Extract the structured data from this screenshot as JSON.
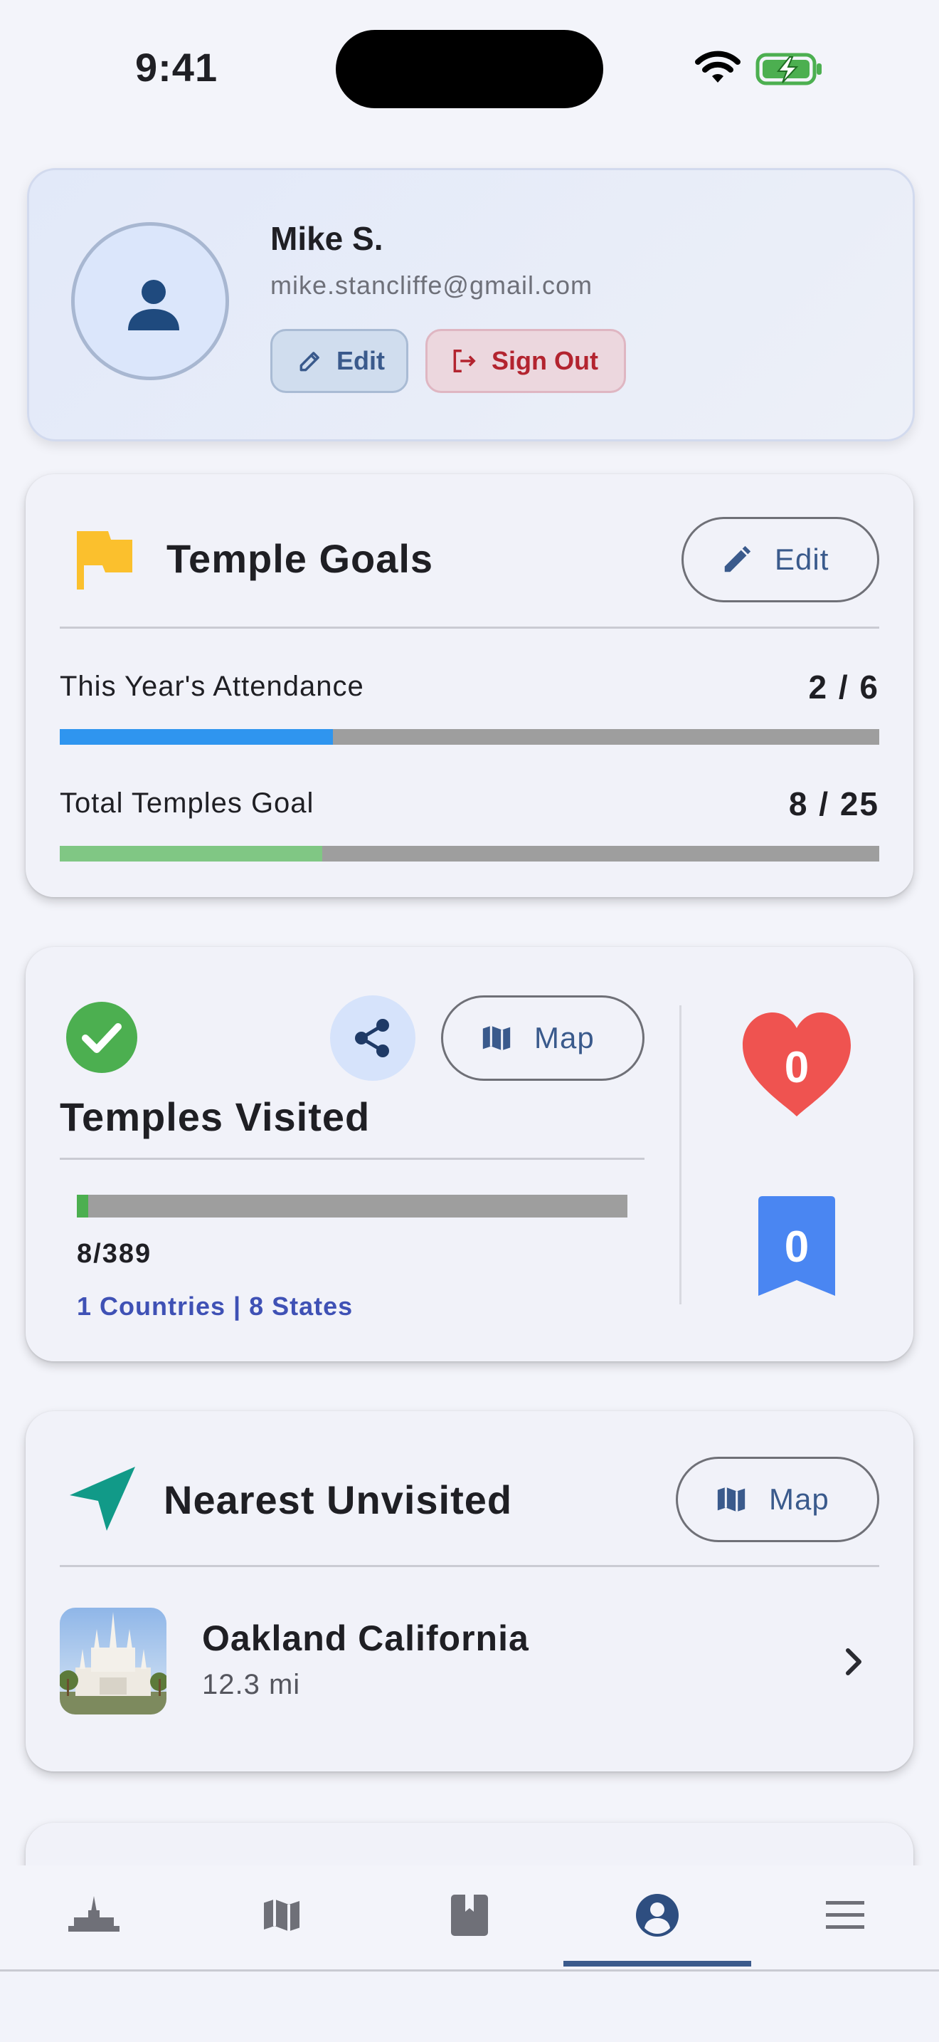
{
  "status_bar": {
    "time": "9:41"
  },
  "profile": {
    "name": "Mike S.",
    "email": "mike.stancliffe@gmail.com",
    "edit_label": "Edit",
    "signout_label": "Sign Out"
  },
  "goals": {
    "title": "Temple Goals",
    "edit_label": "Edit",
    "rows": [
      {
        "label": "This Year's Attendance",
        "value": "2 / 6",
        "progress": 0.333,
        "color": "#2f95ef"
      },
      {
        "label": "Total Temples Goal",
        "value": "8 / 25",
        "progress": 0.32,
        "color": "#80c784"
      }
    ]
  },
  "visited": {
    "title": "Temples Visited",
    "map_label": "Map",
    "count": "8/389",
    "progress": 0.0206,
    "progress_color": "#4caf50",
    "subtitle": "1 Countries | 8 States",
    "favorites_count": "0",
    "bookmarks_count": "0",
    "heart_color": "#ef5350",
    "bookmark_color": "#4a86f2"
  },
  "nearest": {
    "title": "Nearest Unvisited",
    "map_label": "Map",
    "temple_name": "Oakland California",
    "distance": "12.3 mi"
  },
  "nav": {
    "items": [
      "temples-icon",
      "map-icon",
      "journal-icon",
      "profile-icon",
      "menu-icon"
    ],
    "active_index": 3
  },
  "colors": {
    "accent": "#3b5a8c",
    "flag": "#fbc02d",
    "check": "#4caf50",
    "navigation_arrow": "#119a88",
    "signout": "#b3242f"
  }
}
